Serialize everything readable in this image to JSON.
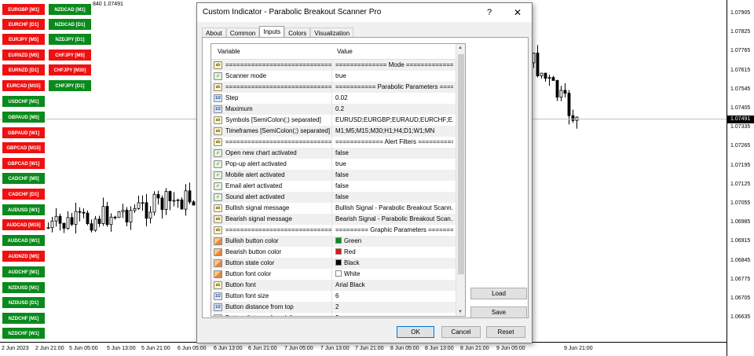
{
  "chart": {
    "top_price": "840 1.07491",
    "current_price": "1.07491",
    "price_labels": [
      "1.07905",
      "1.07825",
      "1.07765",
      "1.07615",
      "1.07545",
      "1.07405",
      "1.07335",
      "1.07265",
      "1.07195",
      "1.07125",
      "1.07055",
      "1.06985",
      "1.06915",
      "1.06845",
      "1.06775",
      "1.06705",
      "1.06635"
    ],
    "time_labels": [
      "2 Jun 2023",
      "2 Jun 21:00",
      "5 Jun 05:00",
      "5 Jun 13:00",
      "5 Jun 21:00",
      "6 Jun 05:00",
      "6 Jun 13:00",
      "6 Jun 21:00",
      "7 Jun 05:00",
      "7 Jun 13:00",
      "7 Jun 21:00",
      "8 Jun 05:00",
      "8 Jun 13:00",
      "8 Jun 21:00",
      "9 Jun 05:00",
      "9 Jun 21:00"
    ]
  },
  "scanner_buttons": [
    {
      "label": "EURGBP  [M1]",
      "color": "red"
    },
    {
      "label": "NZDCAD  [M1]",
      "color": "green"
    },
    {
      "label": "EURCHF  [D1]",
      "color": "red"
    },
    {
      "label": "NZDCAD  [D1]",
      "color": "green"
    },
    {
      "label": "EURJPY  [M5]",
      "color": "red"
    },
    {
      "label": "NZDJPY  [D1]",
      "color": "green"
    },
    {
      "label": "EURNZD  [M5]",
      "color": "red"
    },
    {
      "label": "CHFJPY  [M5]",
      "color": "red"
    },
    {
      "label": "EURNZD  [D1]",
      "color": "red"
    },
    {
      "label": "CHFJPY  [M30]",
      "color": "red"
    },
    {
      "label": "EURCAD  [M15]",
      "color": "red"
    },
    {
      "label": "CHFJPY  [D1]",
      "color": "green"
    },
    {
      "label": "USDCHF  [M1]",
      "color": "green"
    },
    {
      "label": "GBPAUD  [M5]",
      "color": "green"
    },
    {
      "label": "GBPAUD  [W1]",
      "color": "red"
    },
    {
      "label": "GBPCAD  [M15]",
      "color": "red"
    },
    {
      "label": "GBPCAD  [W1]",
      "color": "red"
    },
    {
      "label": "CADCHF  [M5]",
      "color": "green"
    },
    {
      "label": "CADCHF  [D1]",
      "color": "red"
    },
    {
      "label": "AUDUSD  [W1]",
      "color": "green"
    },
    {
      "label": "AUDCAD  [M15]",
      "color": "red"
    },
    {
      "label": "AUDCAD  [W1]",
      "color": "green"
    },
    {
      "label": "AUDNZD  [M5]",
      "color": "red"
    },
    {
      "label": "AUDCHF  [M1]",
      "color": "green"
    },
    {
      "label": "NZDUSD  [M1]",
      "color": "green"
    },
    {
      "label": "NZDUSD  [D1]",
      "color": "green"
    },
    {
      "label": "NZDCHF  [M1]",
      "color": "green"
    },
    {
      "label": "NZDCHF  [W1]",
      "color": "green"
    },
    {
      "label": "NZDCHF  [M5]",
      "color": "green"
    }
  ],
  "dialog": {
    "title": "Custom Indicator - Parabolic Breakout Scanner Pro",
    "help_label": "?",
    "close_label": "✕",
    "tabs": [
      "About",
      "Common",
      "Inputs",
      "Colors",
      "Visualization"
    ],
    "active_tab": "Inputs",
    "columns": {
      "variable": "Variable",
      "value": "Value"
    },
    "rows": [
      {
        "icon": "ab",
        "variable": "================================",
        "value": "============== Mode =============="
      },
      {
        "icon": "bool",
        "variable": "Scanner mode",
        "value": "true"
      },
      {
        "icon": "ab",
        "variable": "================================",
        "value": "=========== Parabolic Parameters ====="
      },
      {
        "icon": "num",
        "variable": "Step",
        "value": "0.02"
      },
      {
        "icon": "num",
        "variable": "Maximum",
        "value": "0.2"
      },
      {
        "icon": "ab",
        "variable": "Symbols [SemiColon(;) separated]",
        "value": "EURUSD;EURGBP;EURAUD;EURCHF;E..."
      },
      {
        "icon": "ab",
        "variable": "Timeframes [SemiColon(;) separated]",
        "value": "M1;M5;M15;M30;H1;H4;D1;W1;MN"
      },
      {
        "icon": "ab",
        "variable": "================================",
        "value": "============= Alert Filters ============"
      },
      {
        "icon": "bool",
        "variable": "Open new chart activated",
        "value": "false"
      },
      {
        "icon": "bool",
        "variable": "Pop-up alert activated",
        "value": "true"
      },
      {
        "icon": "bool",
        "variable": "Mobile alert activated",
        "value": "false"
      },
      {
        "icon": "bool",
        "variable": "Email alert activated",
        "value": "false"
      },
      {
        "icon": "bool",
        "variable": "Sound alert activated",
        "value": "false"
      },
      {
        "icon": "ab",
        "variable": "Bullish signal message",
        "value": " Bullish Signal - Parabolic Breakout Scann..."
      },
      {
        "icon": "ab",
        "variable": "Bearish signal message",
        "value": " Bearish Signal - Parabolic Breakout Scan..."
      },
      {
        "icon": "ab",
        "variable": "================================",
        "value": "========= Graphic Parameters ========"
      },
      {
        "icon": "color",
        "variable": "Bullish button color",
        "value": "Green",
        "swatch": "#0a8a1c"
      },
      {
        "icon": "color",
        "variable": "Bearish button color",
        "value": "Red",
        "swatch": "#ee1111"
      },
      {
        "icon": "color",
        "variable": "Button state color",
        "value": "Black",
        "swatch": "#000000"
      },
      {
        "icon": "color",
        "variable": "Button font color",
        "value": "White",
        "swatch": "#ffffff"
      },
      {
        "icon": "ab",
        "variable": "Button font",
        "value": "Arial Black"
      },
      {
        "icon": "num",
        "variable": "Button font size",
        "value": "6"
      },
      {
        "icon": "num",
        "variable": "Button distance from top",
        "value": "2"
      },
      {
        "icon": "num",
        "variable": "Button distance from left",
        "value": "3"
      }
    ],
    "load_label": "Load",
    "save_label": "Save",
    "ok_label": "OK",
    "cancel_label": "Cancel",
    "reset_label": "Reset"
  }
}
